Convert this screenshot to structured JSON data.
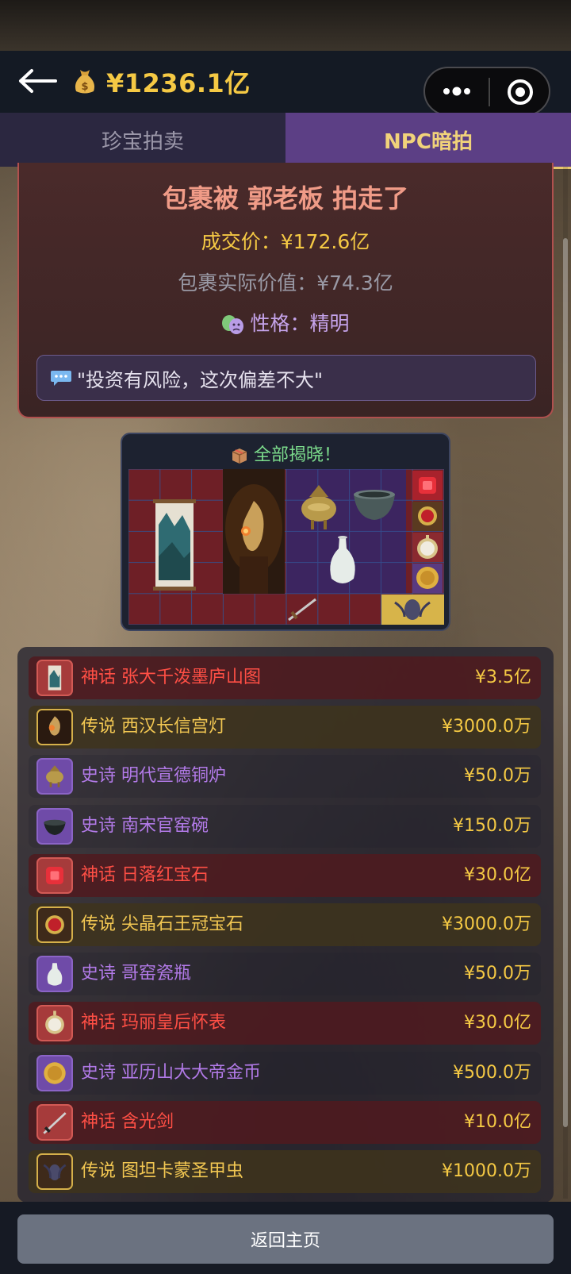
{
  "header": {
    "money": "¥1236.1亿",
    "icons": {
      "back": "back-arrow-icon",
      "money": "money-bag-icon",
      "more": "more-dots-icon",
      "target": "target-circle-icon"
    }
  },
  "tabs": [
    {
      "label": "珍宝拍卖",
      "active": false
    },
    {
      "label": "NPC暗拍",
      "active": true
    }
  ],
  "result": {
    "title": "包裹被 郭老板 拍走了",
    "deal_price": "成交价：¥172.6亿",
    "actual_value": "包裹实际价值：¥74.3亿",
    "personality": "性格：精明",
    "quote": "\"投资有风险，这次偏差不大\""
  },
  "reveal": {
    "title": "全部揭晓！"
  },
  "items": [
    {
      "rarity": "神话",
      "name": "张大千泼墨庐山图",
      "price": "¥3.5亿",
      "tier": "mythic",
      "icon": "landscape-scroll-icon"
    },
    {
      "rarity": "传说",
      "name": "西汉长信宫灯",
      "price": "¥3000.0万",
      "tier": "legend",
      "icon": "bronze-lamp-icon"
    },
    {
      "rarity": "史诗",
      "name": "明代宣德铜炉",
      "price": "¥50.0万",
      "tier": "epic",
      "icon": "bronze-censer-icon"
    },
    {
      "rarity": "史诗",
      "name": "南宋官窑碗",
      "price": "¥150.0万",
      "tier": "epic",
      "icon": "celadon-bowl-icon"
    },
    {
      "rarity": "神话",
      "name": "日落红宝石",
      "price": "¥30.0亿",
      "tier": "mythic",
      "icon": "ruby-icon"
    },
    {
      "rarity": "传说",
      "name": "尖晶石王冠宝石",
      "price": "¥3000.0万",
      "tier": "legend",
      "icon": "spinel-gem-icon"
    },
    {
      "rarity": "史诗",
      "name": "哥窑瓷瓶",
      "price": "¥50.0万",
      "tier": "epic",
      "icon": "porcelain-vase-icon"
    },
    {
      "rarity": "神话",
      "name": "玛丽皇后怀表",
      "price": "¥30.0亿",
      "tier": "mythic",
      "icon": "pocket-watch-icon"
    },
    {
      "rarity": "史诗",
      "name": "亚历山大大帝金币",
      "price": "¥500.0万",
      "tier": "epic",
      "icon": "gold-coin-icon"
    },
    {
      "rarity": "神话",
      "name": "含光剑",
      "price": "¥10.0亿",
      "tier": "mythic",
      "icon": "sword-icon"
    },
    {
      "rarity": "传说",
      "name": "图坦卡蒙圣甲虫",
      "price": "¥1000.0万",
      "tier": "legend",
      "icon": "scarab-icon"
    }
  ],
  "footer": {
    "home_label": "返回主页"
  },
  "colors": {
    "mythic": "#ff4f45",
    "legend": "#f2c752",
    "epic": "#b27ae8",
    "gold": "#f5c944",
    "tab_active": "#5c3f85"
  }
}
